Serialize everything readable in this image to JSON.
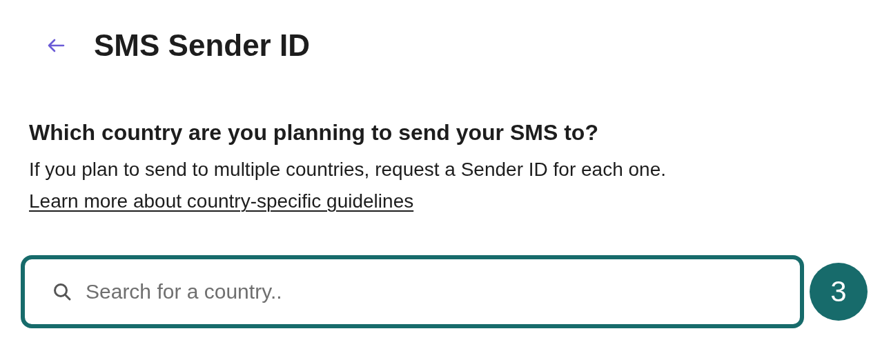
{
  "header": {
    "title": "SMS Sender ID"
  },
  "question": {
    "heading": "Which country are you planning to send your SMS to?",
    "description": "If you plan to send to multiple countries, request a Sender ID for each one.",
    "link": "Learn more about country-specific guidelines"
  },
  "search": {
    "placeholder": "Search for a country.."
  },
  "step_badge": "3"
}
